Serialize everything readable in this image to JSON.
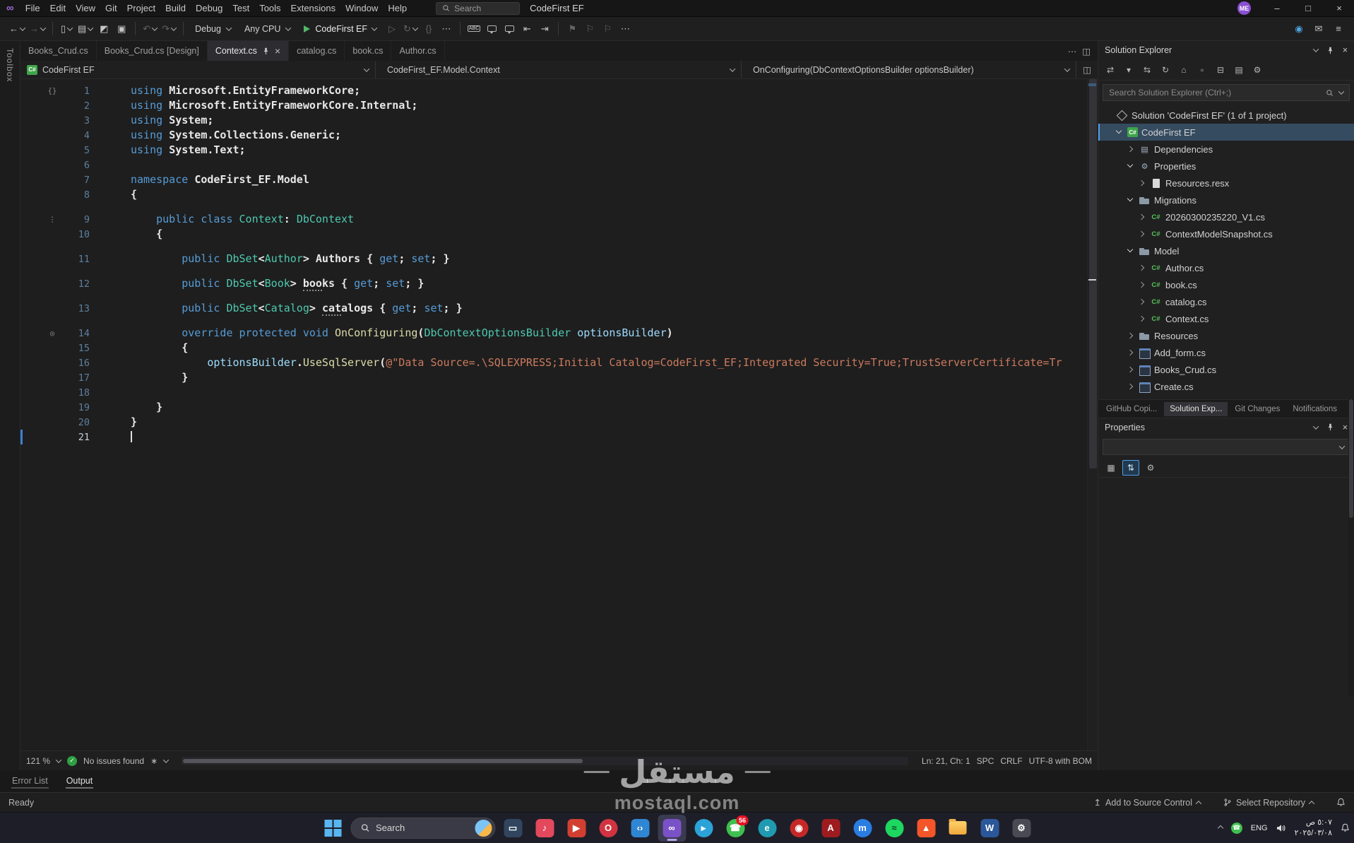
{
  "titlebar": {
    "menu": [
      "File",
      "Edit",
      "View",
      "Git",
      "Project",
      "Build",
      "Debug",
      "Test",
      "Tools",
      "Extensions",
      "Window",
      "Help"
    ],
    "search": "Search",
    "solution": "CodeFirst EF",
    "account": "ME"
  },
  "toolbar": {
    "config": "Debug",
    "platform": "Any CPU",
    "run": "CodeFirst EF"
  },
  "tabs": {
    "items": [
      {
        "label": "Books_Crud.cs",
        "active": false
      },
      {
        "label": "Books_Crud.cs [Design]",
        "active": false
      },
      {
        "label": "Context.cs",
        "active": true
      },
      {
        "label": "catalog.cs",
        "active": false
      },
      {
        "label": "book.cs",
        "active": false
      },
      {
        "label": "Author.cs",
        "active": false
      }
    ]
  },
  "breadcrumb": {
    "project": "CodeFirst EF",
    "type": "CodeFirst_EF.Model.Context",
    "member": "OnConfiguring(DbContextOptionsBuilder optionsBuilder)"
  },
  "editor": {
    "zoom": "121 %",
    "health": "No issues found",
    "position": "Ln: 21, Ch: 1",
    "indent": "SPC",
    "eol": "CRLF",
    "encoding": "UTF-8 with BOM",
    "lines": [
      {
        "n": 1,
        "g": "references",
        "tk": [
          [
            "k",
            "using "
          ],
          [
            "w",
            "Microsoft.EntityFrameworkCore;"
          ]
        ]
      },
      {
        "n": 2,
        "tk": [
          [
            "k",
            "using "
          ],
          [
            "w",
            "Microsoft.EntityFrameworkCore.Internal;"
          ]
        ]
      },
      {
        "n": 3,
        "tk": [
          [
            "k",
            "using "
          ],
          [
            "w",
            "System;"
          ]
        ]
      },
      {
        "n": 4,
        "tk": [
          [
            "k",
            "using "
          ],
          [
            "w",
            "System.Collections.Generic;"
          ]
        ]
      },
      {
        "n": 5,
        "tk": [
          [
            "k",
            "using "
          ],
          [
            "w",
            "System.Text;"
          ]
        ]
      },
      {
        "n": 6,
        "tk": []
      },
      {
        "n": 7,
        "tk": [
          [
            "k",
            "namespace "
          ],
          [
            "w",
            "CodeFirst_EF.Model"
          ]
        ]
      },
      {
        "n": 8,
        "tk": [
          [
            "w",
            "{"
          ]
        ]
      },
      {
        "n": 9,
        "lens": true,
        "g": "marker",
        "tk": [
          [
            "w",
            "    "
          ],
          [
            "k",
            "public class "
          ],
          [
            "t",
            "Context"
          ],
          [
            "w",
            ": "
          ],
          [
            "t",
            "DbContext"
          ]
        ]
      },
      {
        "n": 10,
        "tk": [
          [
            "w",
            "    {"
          ]
        ]
      },
      {
        "n": 11,
        "lens": true,
        "tk": [
          [
            "w",
            "        "
          ],
          [
            "k",
            "public "
          ],
          [
            "t",
            "DbSet"
          ],
          [
            "w",
            "<"
          ],
          [
            "t",
            "Author"
          ],
          [
            "w",
            "> Authors { "
          ],
          [
            "k",
            "get"
          ],
          [
            "w",
            "; "
          ],
          [
            "k",
            "set"
          ],
          [
            "w",
            "; }"
          ]
        ]
      },
      {
        "n": 12,
        "lens": true,
        "tk": [
          [
            "w",
            "        "
          ],
          [
            "k",
            "public "
          ],
          [
            "t",
            "DbSet"
          ],
          [
            "w",
            "<"
          ],
          [
            "t",
            "Book"
          ],
          [
            "w",
            "> "
          ],
          [
            "w sug",
            "boo"
          ],
          [
            "w",
            "ks { "
          ],
          [
            "k",
            "get"
          ],
          [
            "w",
            "; "
          ],
          [
            "k",
            "set"
          ],
          [
            "w",
            "; }"
          ]
        ]
      },
      {
        "n": 13,
        "lens": true,
        "tk": [
          [
            "w",
            "        "
          ],
          [
            "k",
            "public "
          ],
          [
            "t",
            "DbSet"
          ],
          [
            "w",
            "<"
          ],
          [
            "t",
            "Catalog"
          ],
          [
            "w",
            "> "
          ],
          [
            "w sug",
            "cat"
          ],
          [
            "w",
            "alogs { "
          ],
          [
            "k",
            "get"
          ],
          [
            "w",
            "; "
          ],
          [
            "k",
            "set"
          ],
          [
            "w",
            "; }"
          ]
        ]
      },
      {
        "n": 14,
        "lens": true,
        "g": "override",
        "tk": [
          [
            "w",
            "        "
          ],
          [
            "k",
            "override protected void "
          ],
          [
            "m",
            "OnConfiguring"
          ],
          [
            "w",
            "("
          ],
          [
            "t",
            "DbContextOptionsBuilder"
          ],
          [
            "w",
            " "
          ],
          [
            "p",
            "optionsBuilder"
          ],
          [
            "w",
            ")"
          ]
        ]
      },
      {
        "n": 15,
        "tk": [
          [
            "w",
            "        {"
          ]
        ]
      },
      {
        "n": 16,
        "tk": [
          [
            "w",
            "            "
          ],
          [
            "p",
            "optionsBuilder"
          ],
          [
            "w",
            "."
          ],
          [
            "m",
            "UseSqlServer"
          ],
          [
            "w",
            "("
          ],
          [
            "s",
            "@\"Data Source=.\\SQLEXPRESS;Initial Catalog=CodeFirst_EF;Integrated Security=True;TrustServerCertificate=Tr"
          ]
        ]
      },
      {
        "n": 17,
        "tk": [
          [
            "w",
            "        }"
          ]
        ]
      },
      {
        "n": 18,
        "tk": []
      },
      {
        "n": 19,
        "tk": [
          [
            "w",
            "    }"
          ]
        ]
      },
      {
        "n": 20,
        "tk": [
          [
            "w",
            "}"
          ]
        ]
      },
      {
        "n": 21,
        "cursor": true,
        "tk": []
      }
    ]
  },
  "toolbox_label": "Toolbox",
  "solution_explorer": {
    "title": "Solution Explorer",
    "search_placeholder": "Search Solution Explorer (Ctrl+;)",
    "tree": [
      {
        "label": "Solution 'CodeFirst EF' (1 of 1 project)",
        "icon": "solution",
        "indent": 0
      },
      {
        "label": "CodeFirst EF",
        "icon": "csproj",
        "indent": 1,
        "chev": "open",
        "selected": true
      },
      {
        "label": "Dependencies",
        "icon": "dependencies",
        "indent": 2,
        "chev": "closed"
      },
      {
        "label": "Properties",
        "icon": "properties",
        "indent": 2,
        "chev": "open"
      },
      {
        "label": "Resources.resx",
        "icon": "resx",
        "indent": 3,
        "chev": "closed"
      },
      {
        "label": "Migrations",
        "icon": "folder",
        "indent": 2,
        "chev": "open"
      },
      {
        "label": "20260300235220_V1.cs",
        "icon": "cs",
        "indent": 3,
        "chev": "closed"
      },
      {
        "label": "ContextModelSnapshot.cs",
        "icon": "cs",
        "indent": 3,
        "chev": "closed"
      },
      {
        "label": "Model",
        "icon": "folder",
        "indent": 2,
        "chev": "open"
      },
      {
        "label": "Author.cs",
        "icon": "cs",
        "indent": 3,
        "chev": "closed"
      },
      {
        "label": "book.cs",
        "icon": "cs",
        "indent": 3,
        "chev": "closed"
      },
      {
        "label": "catalog.cs",
        "icon": "cs",
        "indent": 3,
        "chev": "closed"
      },
      {
        "label": "Context.cs",
        "icon": "cs",
        "indent": 3,
        "chev": "closed"
      },
      {
        "label": "Resources",
        "icon": "folder",
        "indent": 2,
        "chev": "closed"
      },
      {
        "label": "Add_form.cs",
        "icon": "form",
        "indent": 2,
        "chev": "closed"
      },
      {
        "label": "Books_Crud.cs",
        "icon": "form",
        "indent": 2,
        "chev": "closed"
      },
      {
        "label": "Create.cs",
        "icon": "form",
        "indent": 2,
        "chev": "closed"
      }
    ],
    "panel_tabs": [
      {
        "label": "GitHub Copi...",
        "active": false
      },
      {
        "label": "Solution Exp...",
        "active": true
      },
      {
        "label": "Git Changes",
        "active": false
      },
      {
        "label": "Notifications",
        "active": false
      }
    ]
  },
  "properties_panel": {
    "title": "Properties"
  },
  "output_tabs": [
    {
      "label": "Error List",
      "active": false
    },
    {
      "label": "Output",
      "active": true
    }
  ],
  "status_bar": {
    "ready": "Ready",
    "add_source": "Add to Source Control",
    "select_repo": "Select Repository"
  },
  "taskbar": {
    "search": "Search",
    "lang": "ENG",
    "time": "٥:٠٧ ص",
    "date": "٢٠٢٥/٠٣/٠٨",
    "apps": [
      {
        "name": "pc-icon",
        "bg": "#31465e",
        "glyph": "▭"
      },
      {
        "name": "apple-music-icon",
        "bg": "#e4485c",
        "glyph": "♪"
      },
      {
        "name": "youtube-icon",
        "bg": "#d23f31",
        "glyph": "▶"
      },
      {
        "name": "opera-icon",
        "bg": "#d13440",
        "glyph": "O",
        "round": true
      },
      {
        "name": "vscode-icon",
        "bg": "#2f86d2",
        "glyph": "‹›"
      },
      {
        "name": "visual-studio-icon",
        "bg": "#7a52c7",
        "glyph": "∞",
        "active": true
      },
      {
        "name": "telegram-icon",
        "bg": "#2ba3d8",
        "glyph": "▸",
        "round": true
      },
      {
        "name": "whatsapp-icon",
        "bg": "#3fbf4f",
        "glyph": "☎",
        "round": true,
        "badge": "56"
      },
      {
        "name": "edge-icon",
        "bg": "#1f9ab0",
        "glyph": "e",
        "round": true
      },
      {
        "name": "youtube-music-icon",
        "bg": "#c62828",
        "glyph": "◉",
        "round": true
      },
      {
        "name": "adobe-icon",
        "bg": "#9e1c20",
        "glyph": "A"
      },
      {
        "name": "messenger-icon",
        "bg": "#2a7de1",
        "glyph": "m",
        "round": true
      },
      {
        "name": "spotify-icon",
        "bg": "#1ed760",
        "glyph": "≈",
        "round": true,
        "fg": "#0b3b17"
      },
      {
        "name": "brave-icon",
        "bg": "#f4562a",
        "glyph": "▲"
      },
      {
        "name": "file-explorer-icon",
        "shape": "folder"
      },
      {
        "name": "word-icon",
        "bg": "#2b579a",
        "glyph": "W"
      },
      {
        "name": "settings-icon",
        "bg": "#4a4a55",
        "glyph": "⚙"
      }
    ]
  },
  "watermark": {
    "title": "مستقل",
    "url": "mostaql.com"
  },
  "icons": {
    "vs-logo-icon": "∞",
    "minimize-icon": "–",
    "maximize-icon": "□",
    "close-icon": "×",
    "navigate-back-icon": "←",
    "navigate-forward-icon": "→",
    "new-file-icon": "▯",
    "open-file-icon": "▤",
    "save-icon": "◩",
    "save-all-icon": "▣",
    "undo-icon": "↶",
    "redo-icon": "↷",
    "start-without-debugging-icon": "▷",
    "hot-reload-icon": "↻",
    "code-braces-icon": "{}",
    "more-commands-icon": "⋯",
    "spell-check-icon": "ABC",
    "outdent-icon": "⇤",
    "indent-icon": "⇥",
    "bookmark-toggle-icon": "⚑",
    "bookmark-prev-icon": "⚐",
    "bookmark-next-icon": "⚐",
    "live-share-icon": "◉",
    "feedback-icon": "✉",
    "task-list-icon": "≡",
    "more-tabs-icon": "⋯",
    "split-editor-icon": "◫",
    "se-switch-views-icon": "⇄",
    "se-pending-changes-icon": "▾",
    "se-sync-icon": "⇆",
    "se-refresh-icon": "↻",
    "se-scope-icon": "⌂",
    "se-new-item-icon": "▫",
    "se-collapse-all-icon": "⊟",
    "se-show-all-icon": "▤",
    "se-properties-icon": "⚙",
    "prop-categorized-icon": "▦",
    "prop-alphabetical-icon": "⇅",
    "prop-pages-icon": "⚙",
    "code-cleanup-icon": "∗",
    "references-icon": "{}",
    "marker-icon": "⋮",
    "override-icon": "◎",
    "tree-cs-icon": "C#",
    "tree-csproj-icon": "C#",
    "tree-dependencies-icon": "▤",
    "tree-properties-icon": "⚙"
  }
}
